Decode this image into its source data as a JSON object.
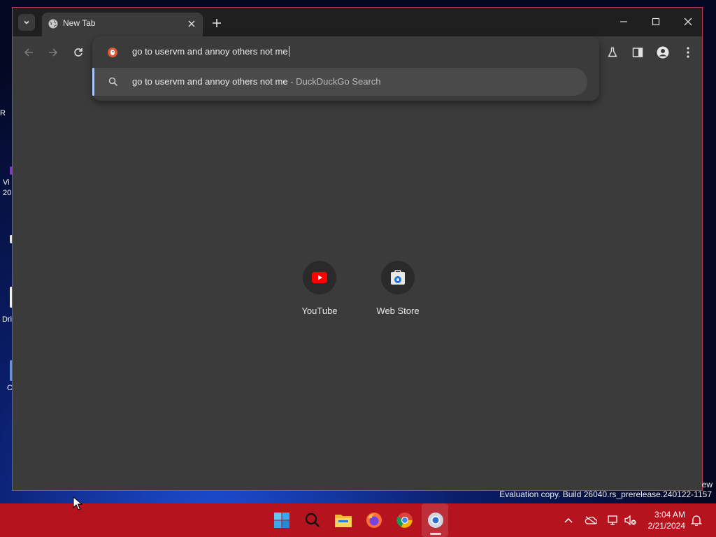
{
  "desktop": {
    "fragments": [
      {
        "text": "R"
      },
      {
        "text": "Vi"
      },
      {
        "text": "20"
      },
      {
        "text": "Dri"
      },
      {
        "text": "C"
      }
    ]
  },
  "browser": {
    "tab": {
      "title": "New Tab",
      "favicon": "globe-icon"
    },
    "toolbar_icons": [
      "back-icon",
      "forward-icon",
      "reload-icon",
      "labs-flask-icon",
      "side-panel-icon",
      "profile-icon",
      "menu-icon"
    ],
    "omnibox": {
      "value": "go to uservm and annoy others not me",
      "search_engine_icon": "duckduckgo-icon"
    },
    "suggestion": {
      "text": "go to uservm and annoy others not me",
      "description": " - DuckDuckGo Search"
    },
    "shortcuts": [
      {
        "label": "YouTube",
        "icon": "youtube-icon"
      },
      {
        "label": "Web Store",
        "icon": "web-store-icon"
      }
    ]
  },
  "watermark": {
    "line1_fragment": "ew",
    "line2": "Evaluation copy. Build 26040.rs_prerelease.240122-1157"
  },
  "taskbar": {
    "apps": [
      "start-icon",
      "search-icon",
      "file-explorer-icon",
      "firefox-icon",
      "chrome-icon",
      "chrome-canary-icon"
    ],
    "tray_icons": [
      "chevron-up-icon",
      "onedrive-icon",
      "network-icon",
      "volume-muted-icon",
      "notification-icon"
    ],
    "time": "3:04 AM",
    "date": "2/21/2024"
  },
  "colors": {
    "window_border": "#c43a55",
    "taskbar": "#b5141e",
    "omnibox_accent": "#a8c7fa"
  }
}
